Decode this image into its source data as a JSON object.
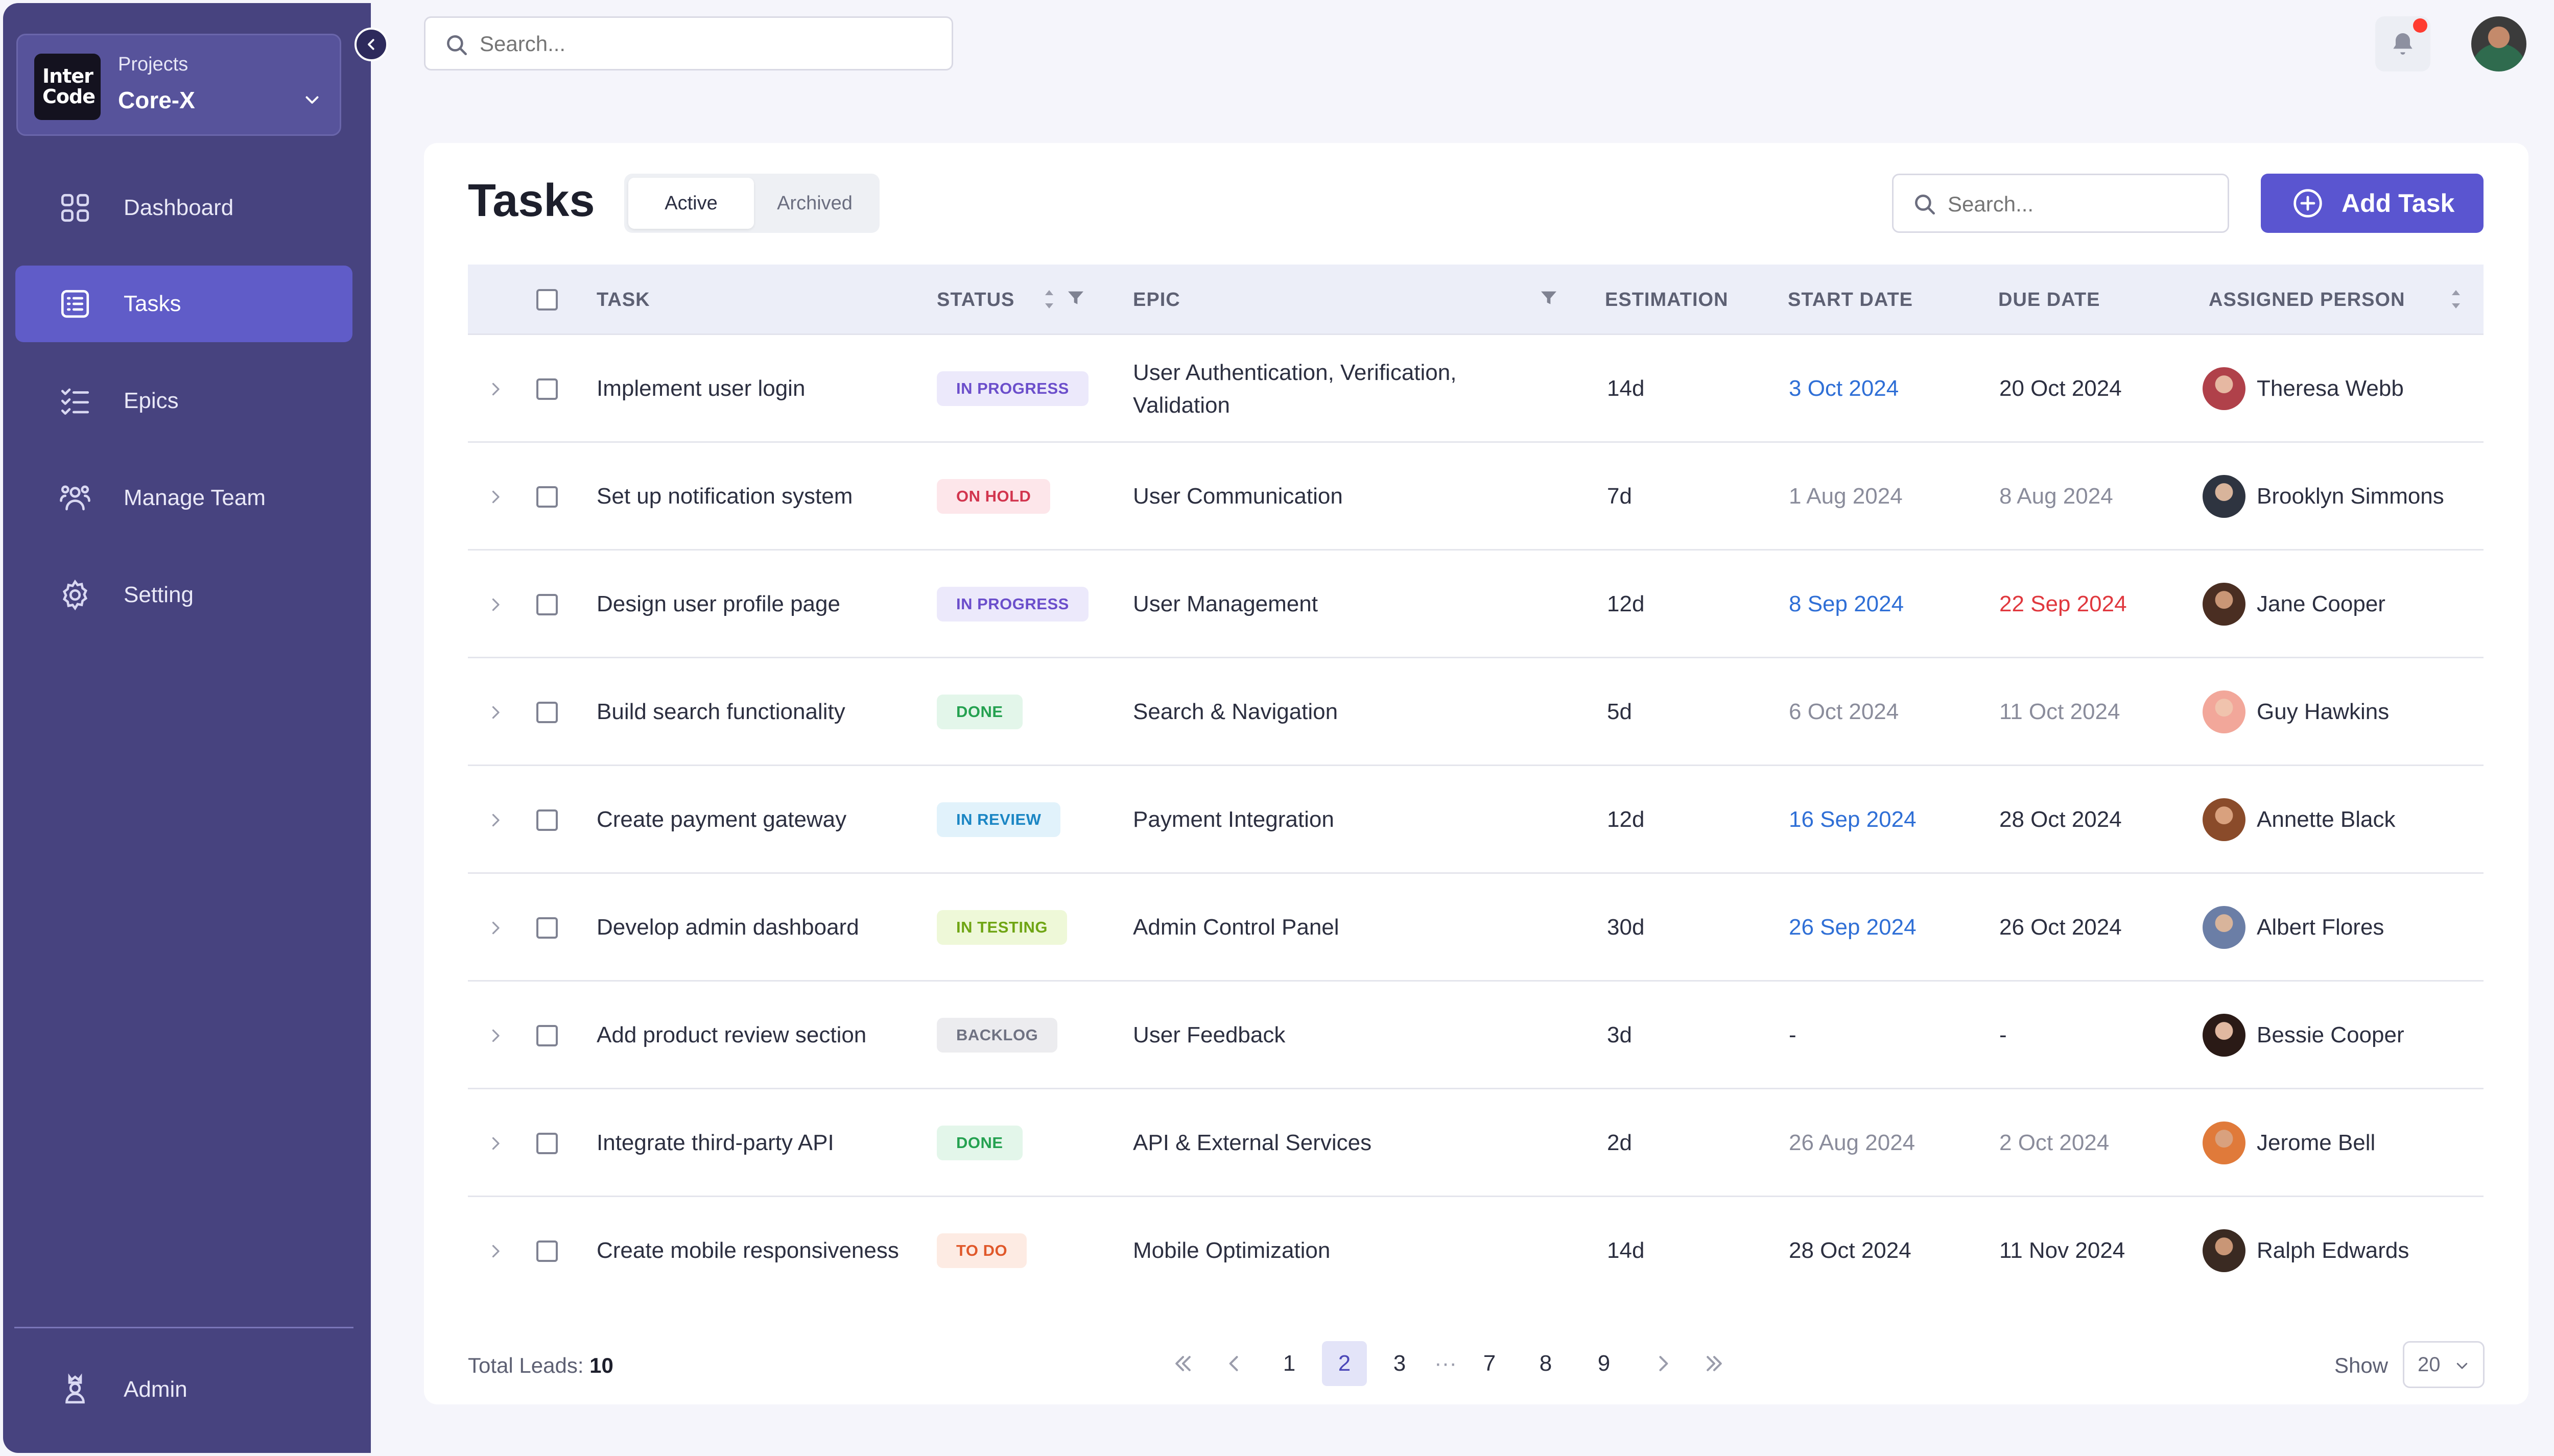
{
  "sidebar": {
    "project_caption": "Projects",
    "project_name": "Core-X",
    "logo_line1": "Inter",
    "logo_line2": "Code",
    "items": [
      {
        "label": "Dashboard",
        "icon": "dashboard-grid-icon"
      },
      {
        "label": "Tasks",
        "icon": "task-list-icon",
        "active": true
      },
      {
        "label": "Epics",
        "icon": "epics-checklist-icon"
      },
      {
        "label": "Manage Team",
        "icon": "team-icon"
      },
      {
        "label": "Setting",
        "icon": "gear-icon"
      }
    ],
    "footer_label": "Admin"
  },
  "topbar": {
    "search_placeholder": "Search...",
    "notification_dot_color": "#ff3b30"
  },
  "page": {
    "title": "Tasks",
    "tabs": [
      {
        "label": "Active",
        "active": true
      },
      {
        "label": "Archived",
        "active": false
      }
    ],
    "search_placeholder": "Search...",
    "add_button_label": "Add Task",
    "accent_color": "#5a55d0"
  },
  "table": {
    "columns": [
      "TASK",
      "STATUS",
      "EPIC",
      "ESTIMATION",
      "START DATE",
      "DUE DATE",
      "ASSIGNED PERSON"
    ],
    "rows": [
      {
        "task": "Implement user login",
        "status": "IN PROGRESS",
        "epic_line1": "User Authentication, Verification,",
        "epic_line2": "Validation",
        "estimation": "14d",
        "start": "3 Oct 2024",
        "due": "20 Oct 2024",
        "person": "Theresa Webb"
      },
      {
        "task": "Set up notification system",
        "status": "ON HOLD",
        "epic": "User Communication",
        "estimation": "7d",
        "start": "1 Aug 2024",
        "due": "8 Aug 2024",
        "person": "Brooklyn Simmons"
      },
      {
        "task": "Design user profile page",
        "status": "IN PROGRESS",
        "epic": "User Management",
        "estimation": "12d",
        "start": "8 Sep 2024",
        "due": "22 Sep 2024",
        "person": "Jane Cooper"
      },
      {
        "task": "Build search functionality",
        "status": "DONE",
        "epic": "Search & Navigation",
        "estimation": "5d",
        "start": "6 Oct 2024",
        "due": "11 Oct 2024",
        "person": "Guy Hawkins"
      },
      {
        "task": "Create payment gateway",
        "status": "IN REVIEW",
        "epic": "Payment Integration",
        "estimation": "12d",
        "start": "16 Sep 2024",
        "due": "28 Oct 2024",
        "person": "Annette Black"
      },
      {
        "task": "Develop admin dashboard",
        "status": "IN TESTING",
        "epic": "Admin Control Panel",
        "estimation": "30d",
        "start": "26 Sep 2024",
        "due": "26 Oct 2024",
        "person": "Albert Flores"
      },
      {
        "task": "Add product review section",
        "status": "BACKLOG",
        "epic": "User Feedback",
        "estimation": "3d",
        "start": "-",
        "due": "-",
        "person": "Bessie Cooper"
      },
      {
        "task": "Integrate third-party API",
        "status": "DONE",
        "epic": "API & External Services",
        "estimation": "2d",
        "start": "26 Aug 2024",
        "due": "2 Oct 2024",
        "person": "Jerome Bell"
      },
      {
        "task": "Create mobile responsiveness",
        "status": "TO DO",
        "epic": "Mobile Optimization",
        "estimation": "14d",
        "start": "28 Oct 2024",
        "due": "11 Nov 2024",
        "person": "Ralph Edwards"
      }
    ]
  },
  "footer": {
    "total_label": "Total Leads:",
    "total_value": "10",
    "pages": [
      "1",
      "2",
      "3",
      "7",
      "8",
      "9"
    ],
    "current_page": "2",
    "ellipsis": "···",
    "show_label": "Show",
    "show_value": "20"
  }
}
